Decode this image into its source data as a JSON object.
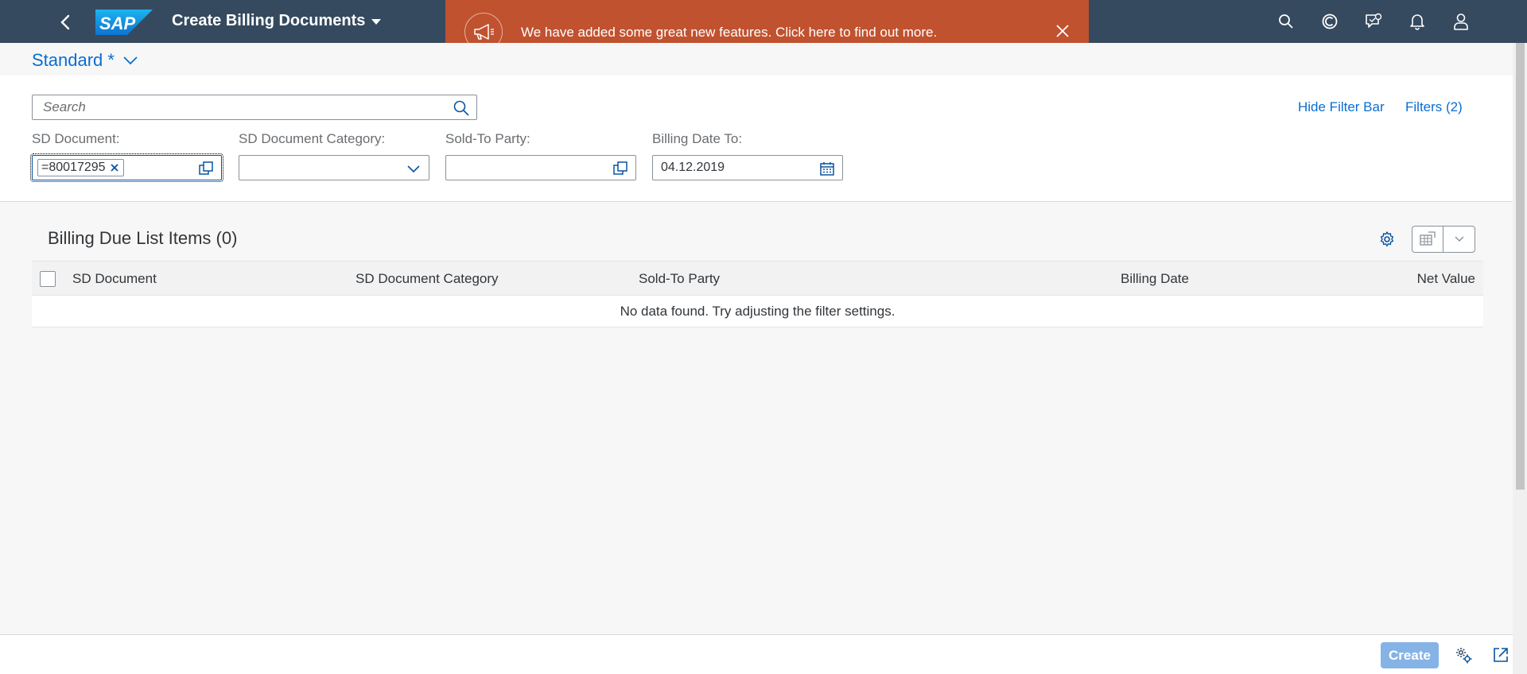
{
  "shell": {
    "logo_text": "SAP",
    "app_title": "Create Billing Documents",
    "icons": [
      "back-icon",
      "search-icon",
      "copilot-icon",
      "feedback-icon",
      "notifications-icon",
      "user-icon"
    ]
  },
  "banner": {
    "message": "We have added some great new features. Click here to find out more.",
    "icon": "megaphone-icon"
  },
  "variant": {
    "name": "Standard *"
  },
  "filterbar": {
    "search_placeholder": "Search",
    "hide_filter_bar": "Hide Filter Bar",
    "filters": "Filters (2)",
    "fields": [
      {
        "label": "SD Document:",
        "token": "=80017295"
      },
      {
        "label": "SD Document Category:",
        "value": ""
      },
      {
        "label": "Sold-To Party:",
        "value": ""
      },
      {
        "label": "Billing Date To:",
        "value": "04.12.2019"
      }
    ]
  },
  "table": {
    "title": "Billing Due List Items (0)",
    "columns": [
      "SD Document",
      "SD Document Category",
      "Sold-To Party",
      "Billing Date",
      "Net Value"
    ],
    "no_data": "No data found. Try adjusting the filter settings."
  },
  "footer": {
    "create_label": "Create"
  },
  "colors": {
    "shell": "#354a5f",
    "banner": "#c1522f",
    "accent": "#0a6ed1",
    "create_button": "#85b3e6"
  }
}
